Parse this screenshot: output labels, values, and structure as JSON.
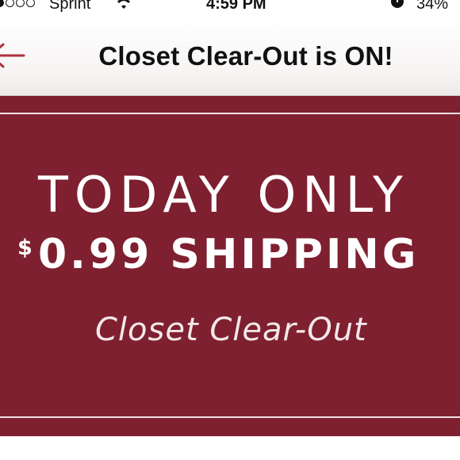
{
  "status_bar": {
    "carrier": "Sprint",
    "time": "4:59 PM",
    "battery": "34%"
  },
  "nav": {
    "title": "Closet Clear-Out is ON!",
    "back_icon": "back-arrow-icon",
    "accent_color": "#b0303e"
  },
  "banner": {
    "headline": "TODAY ONLY",
    "currency": "$",
    "shipping": "0.99 SHIPPING",
    "subhead": "Closet Clear-Out",
    "background_color": "#7e2030"
  }
}
